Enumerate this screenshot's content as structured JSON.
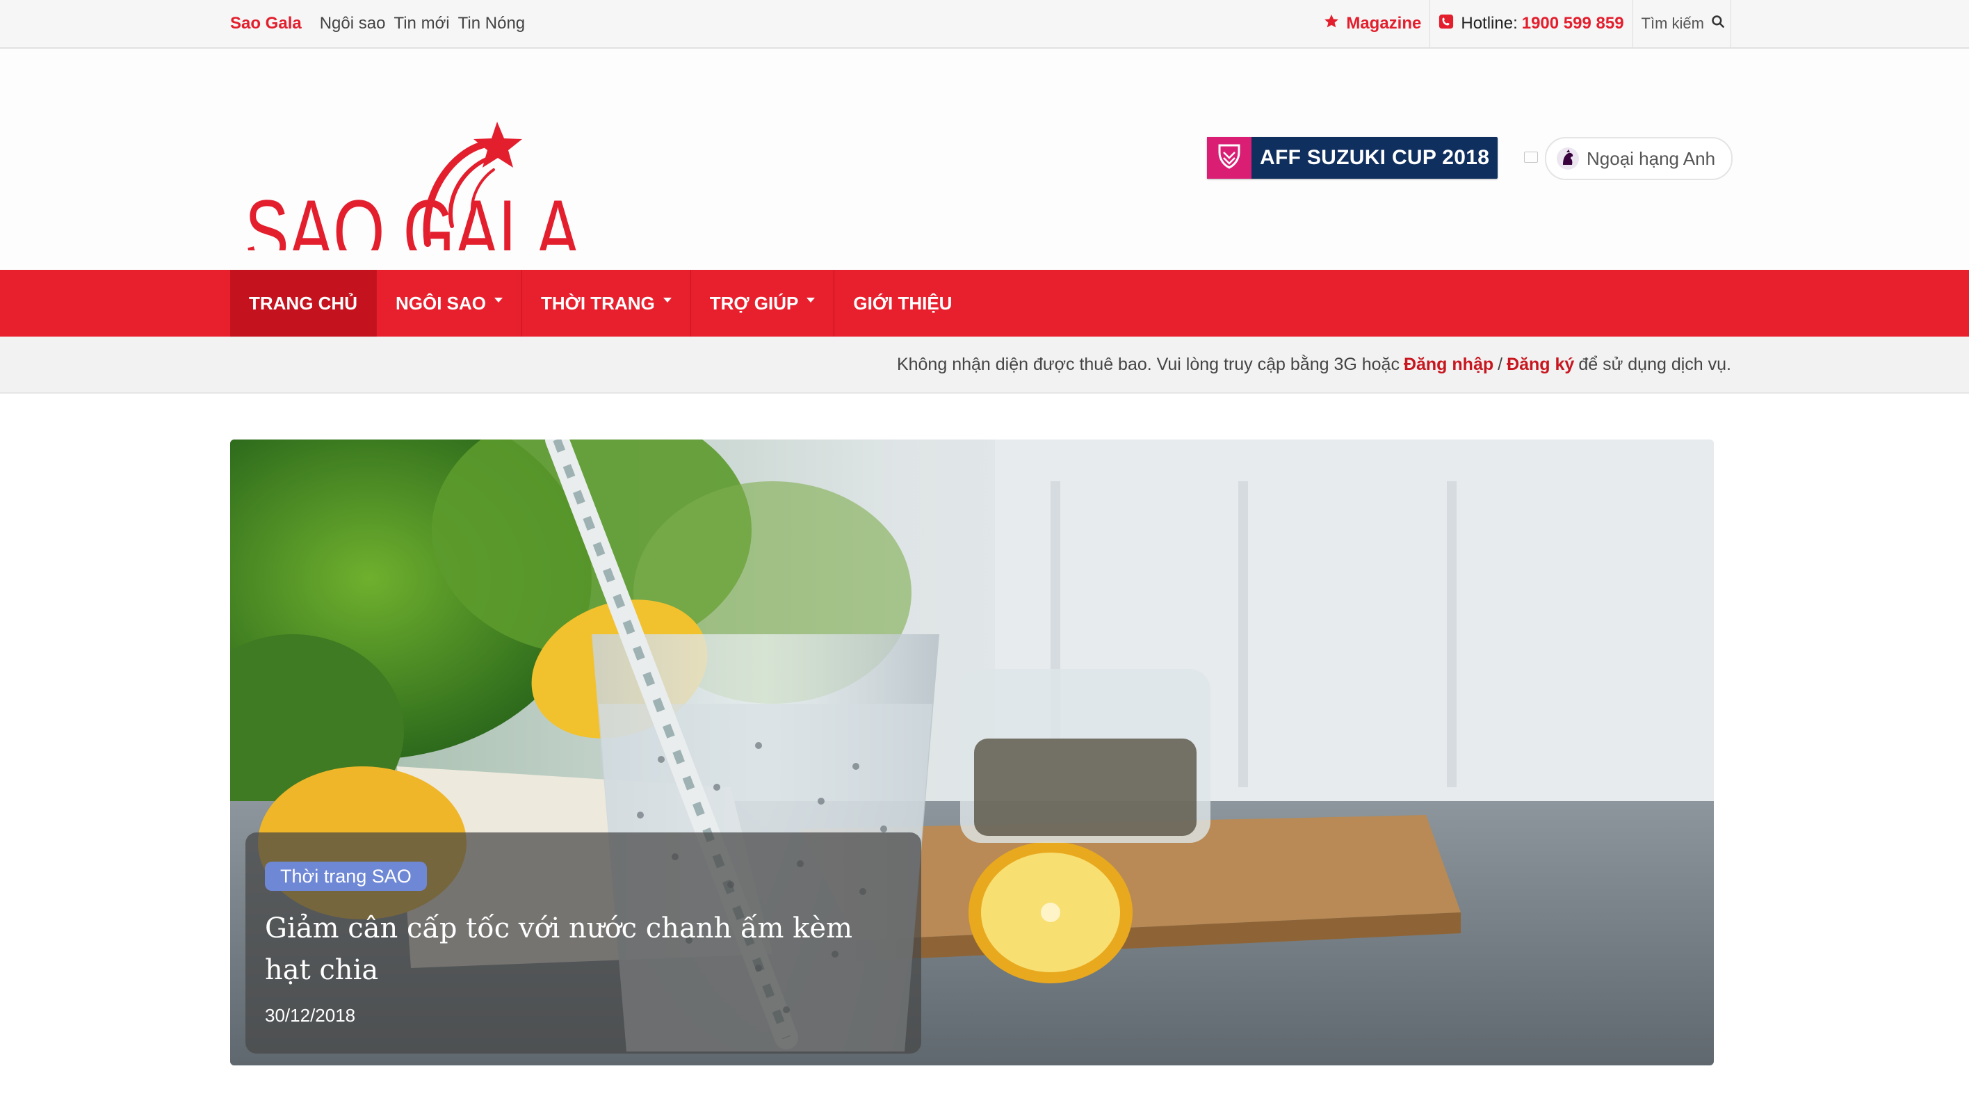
{
  "topbar": {
    "brand": "Sao Gala",
    "links": [
      "Ngôi sao",
      "Tin mới",
      "Tin Nóng"
    ],
    "magazine": "Magazine",
    "hotline_label": "Hotline:",
    "hotline_number": "1900 599 859",
    "search_label": "Tìm kiếm"
  },
  "header": {
    "logo_text": "SAO GALA",
    "promo_label": "AFF SUZUKI CUP 2018",
    "pill_label": "Ngoại hạng Anh"
  },
  "nav": {
    "items": [
      "TRANG CHỦ",
      "NGÔI SAO",
      "THỜI TRANG",
      "TRỢ GIÚP",
      "GIỚI THIỆU"
    ]
  },
  "notice": {
    "text_before": "Không nhận diện được thuê bao. Vui lòng truy cập bằng 3G hoặc",
    "login": "Đăng nhập",
    "separator": "/",
    "register": "Đăng ký",
    "text_after": "để sử dụng dịch vụ."
  },
  "featured": {
    "category": "Thời trang SAO",
    "title": "Giảm cân cấp tốc với nước chanh ấm kèm hạt chia",
    "date": "30/12/2018"
  },
  "colors": {
    "brand_red": "#e8202e",
    "nav_active": "#c4121e",
    "tag_blue": "#6f88d6"
  }
}
